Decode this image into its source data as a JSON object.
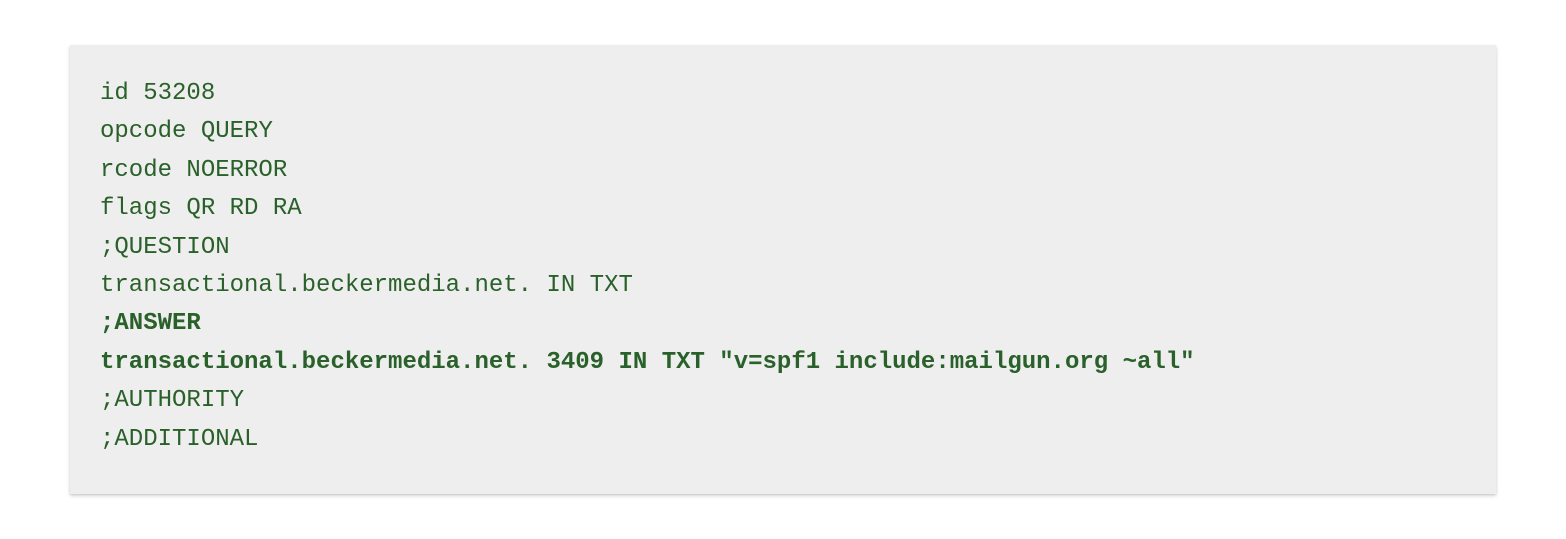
{
  "dns": {
    "id_label": "id",
    "id_value": "53208",
    "opcode_label": "opcode",
    "opcode_value": "QUERY",
    "rcode_label": "rcode",
    "rcode_value": "NOERROR",
    "flags_label": "flags",
    "flags_value": "QR RD RA",
    "question_header": ";QUESTION",
    "question_line": "transactional.beckermedia.net. IN TXT",
    "answer_header": ";ANSWER",
    "answer_line": "transactional.beckermedia.net. 3409 IN TXT \"v=spf1 include:mailgun.org ~all\"",
    "authority_header": ";AUTHORITY",
    "additional_header": ";ADDITIONAL"
  }
}
